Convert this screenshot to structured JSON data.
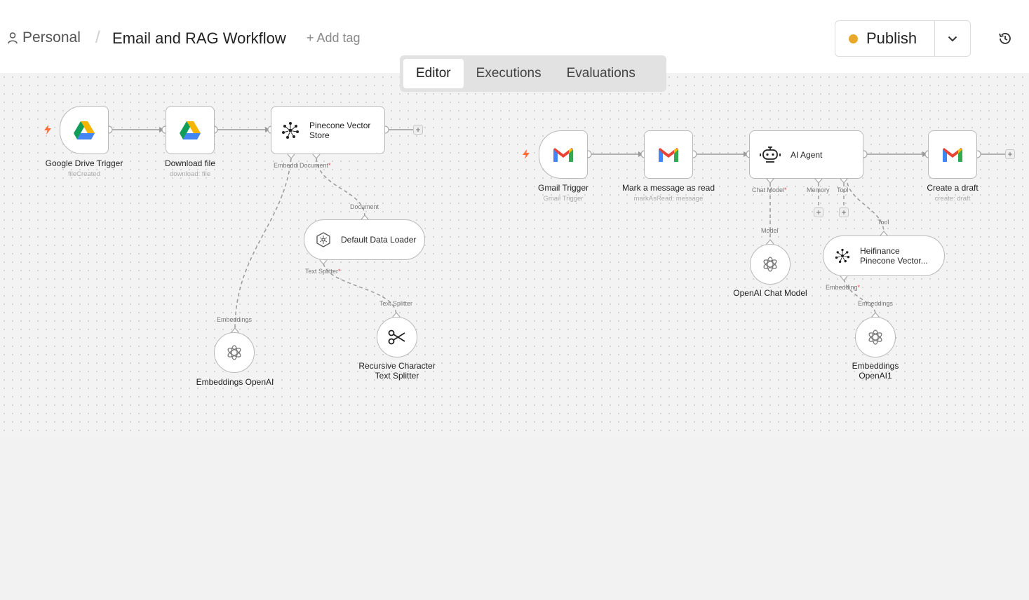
{
  "header": {
    "breadcrumb_personal": "Personal",
    "separator": "/",
    "workflow_title": "Email and RAG Workflow",
    "add_tag": "+ Add tag",
    "publish_label": "Publish",
    "publish_status_color": "#e8a92a"
  },
  "tabs": [
    {
      "label": "Editor",
      "active": true
    },
    {
      "label": "Executions",
      "active": false
    },
    {
      "label": "Evaluations",
      "active": false
    }
  ],
  "workflow_left": {
    "drive_trigger": {
      "title": "Google Drive Trigger",
      "subtitle": "fileCreated",
      "icon": "google-drive-icon"
    },
    "download_file": {
      "title": "Download file",
      "subtitle": "download: file",
      "icon": "google-drive-icon"
    },
    "pinecone_store": {
      "title_line1": "Pinecone Vector",
      "title_line2": "Store",
      "icon": "pinecone-icon",
      "port_embedding": "Embeddi",
      "port_document": "Document"
    },
    "data_loader": {
      "title": "Default Data Loader",
      "port_in": "Document",
      "port_out": "Text Splitter",
      "icon": "data-loader-icon"
    },
    "embeddings": {
      "title": "Embeddings OpenAI",
      "port_in": "Embeddings",
      "icon": "openai-icon"
    },
    "splitter": {
      "title_line1": "Recursive Character",
      "title_line2": "Text Splitter",
      "port_in": "Text Splitter",
      "icon": "scissors-icon"
    }
  },
  "workflow_right": {
    "gmail_trigger": {
      "title": "Gmail Trigger",
      "subtitle": "Gmail Trigger",
      "icon": "gmail-icon"
    },
    "mark_read": {
      "title": "Mark a message as read",
      "subtitle": "markAsRead: message",
      "icon": "gmail-icon"
    },
    "ai_agent": {
      "title": "AI Agent",
      "port_chat_model": "Chat Model",
      "port_memory": "Memory",
      "port_tool": "Tool",
      "icon": "robot-icon"
    },
    "create_draft": {
      "title": "Create a draft",
      "subtitle": "create: draft",
      "icon": "gmail-icon"
    },
    "chat_model": {
      "title": "OpenAI Chat Model",
      "port_in": "Model",
      "icon": "openai-icon"
    },
    "heifinance": {
      "title_line1": "Heifinance",
      "title_line2": "Pinecone Vector...",
      "port_in": "Tool",
      "port_out": "Embedding",
      "icon": "pinecone-icon"
    },
    "embeddings1": {
      "title_line1": "Embeddings",
      "title_line2": "OpenAI1",
      "port_in": "Embeddings",
      "icon": "openai-icon"
    }
  },
  "colors": {
    "canvas": "#f3f3f3",
    "trigger_bolt": "#ff6d3a",
    "required": "#e5484d"
  }
}
